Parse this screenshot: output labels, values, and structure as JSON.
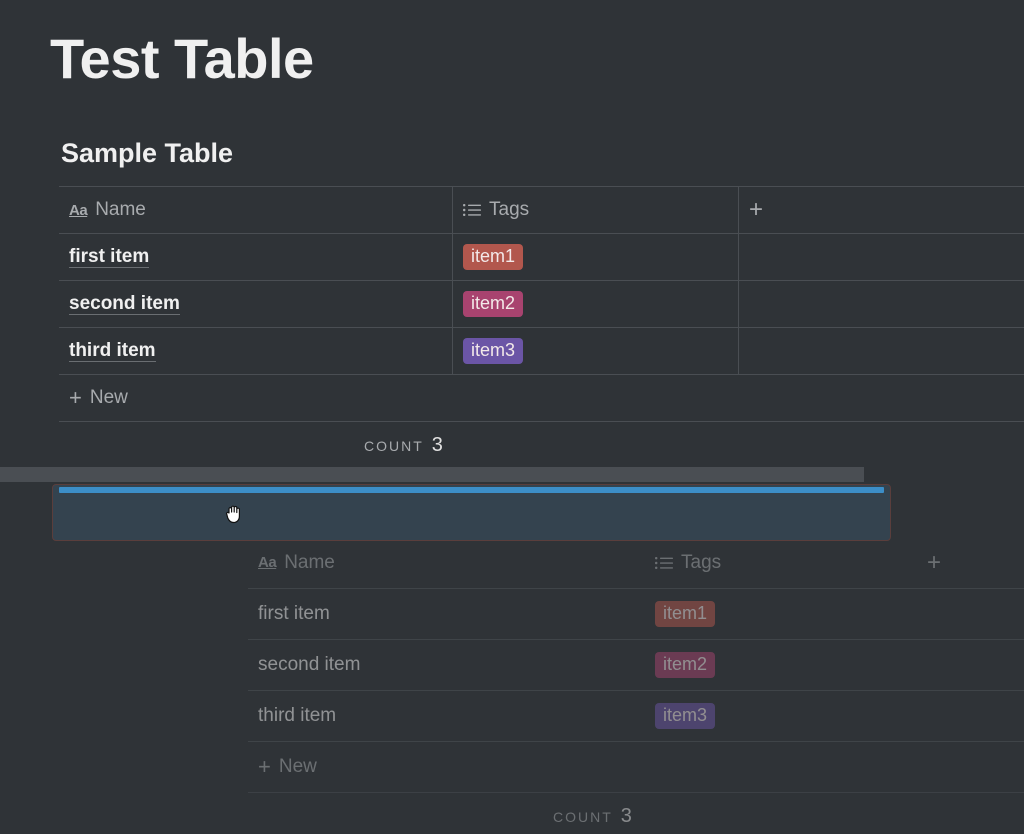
{
  "page": {
    "title": "Test Table"
  },
  "table": {
    "title": "Sample Table",
    "columns": [
      {
        "label": "Name",
        "icon": "text-type-icon",
        "icon_glyph": "Aa"
      },
      {
        "label": "Tags",
        "icon": "list-icon"
      }
    ],
    "rows": [
      {
        "name": "first item",
        "tag": "item1",
        "tag_color": "#b2574d"
      },
      {
        "name": "second item",
        "tag": "item2",
        "tag_color": "#a8436f"
      },
      {
        "name": "third item",
        "tag": "item3",
        "tag_color": "#6b55a6"
      }
    ],
    "new_label": "New",
    "count_label": "COUNT",
    "count_value": "3"
  },
  "colors": {
    "background": "#2f3337",
    "drop_indicator": "#3c8ec8",
    "border": "#4a4e53"
  }
}
